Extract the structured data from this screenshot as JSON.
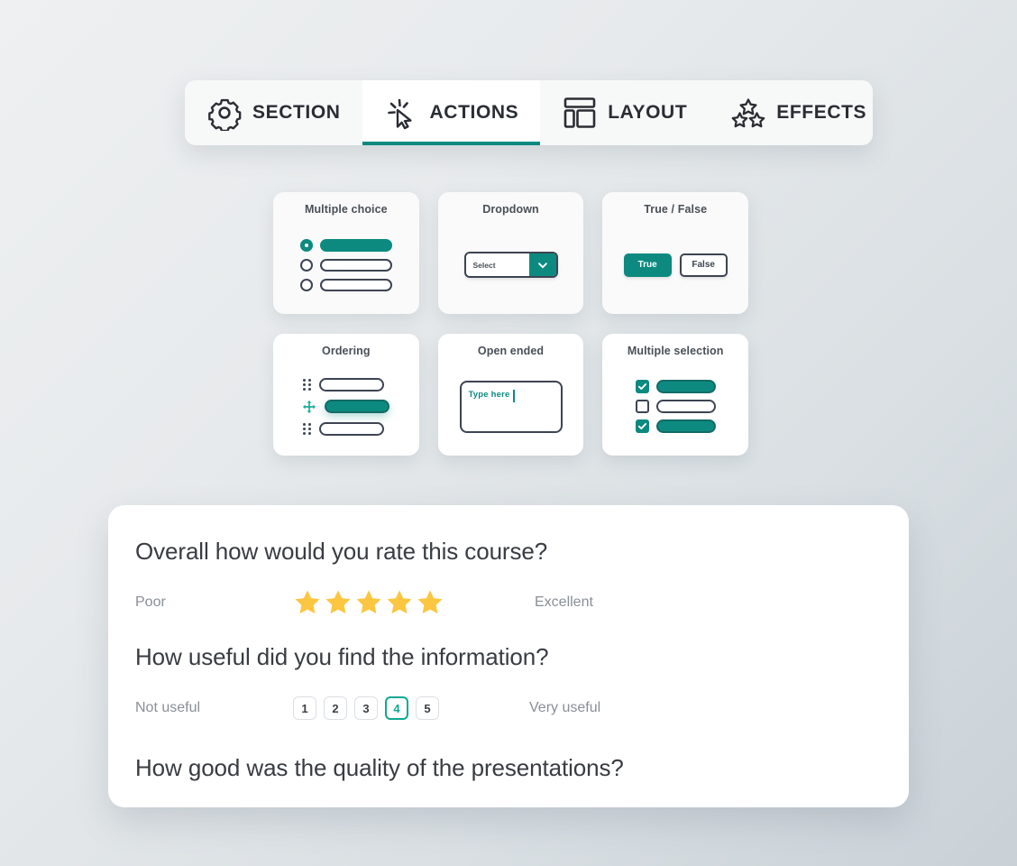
{
  "theme": {
    "accent": "#0c8a80",
    "accent_light": "#0fa893",
    "star": "#fcc640",
    "ink": "#393c41",
    "muted": "#8a8f96"
  },
  "tabbar": {
    "tabs": [
      {
        "label": "SECTION",
        "icon": "gear-icon",
        "active": false
      },
      {
        "label": "ACTIONS",
        "icon": "cursor-click-icon",
        "active": true
      },
      {
        "label": "LAYOUT",
        "icon": "layout-icon",
        "active": false
      },
      {
        "label": "EFFECTS",
        "icon": "stars-icon",
        "active": false
      }
    ]
  },
  "cards": {
    "multiple_choice": {
      "title": "Multiple choice"
    },
    "dropdown": {
      "title": "Dropdown",
      "select_label": "Select"
    },
    "true_false": {
      "title": "True / False",
      "true_label": "True",
      "false_label": "False"
    },
    "ordering": {
      "title": "Ordering"
    },
    "open_ended": {
      "title": "Open ended",
      "placeholder": "Type here"
    },
    "multiple_selection": {
      "title": "Multiple selection"
    }
  },
  "survey": {
    "questions": [
      {
        "text": "Overall how would you rate this course?",
        "type": "star-rating",
        "left_anchor": "Poor",
        "right_anchor": "Excellent",
        "stars_total": 5,
        "stars_filled": 5
      },
      {
        "text": "How useful did you find the information?",
        "type": "numeric-scale",
        "left_anchor": "Not useful",
        "right_anchor": "Very useful",
        "options": [
          "1",
          "2",
          "3",
          "4",
          "5"
        ],
        "selected": "4"
      },
      {
        "text": "How good was the quality of the presentations?",
        "type": "heading-only"
      }
    ]
  }
}
